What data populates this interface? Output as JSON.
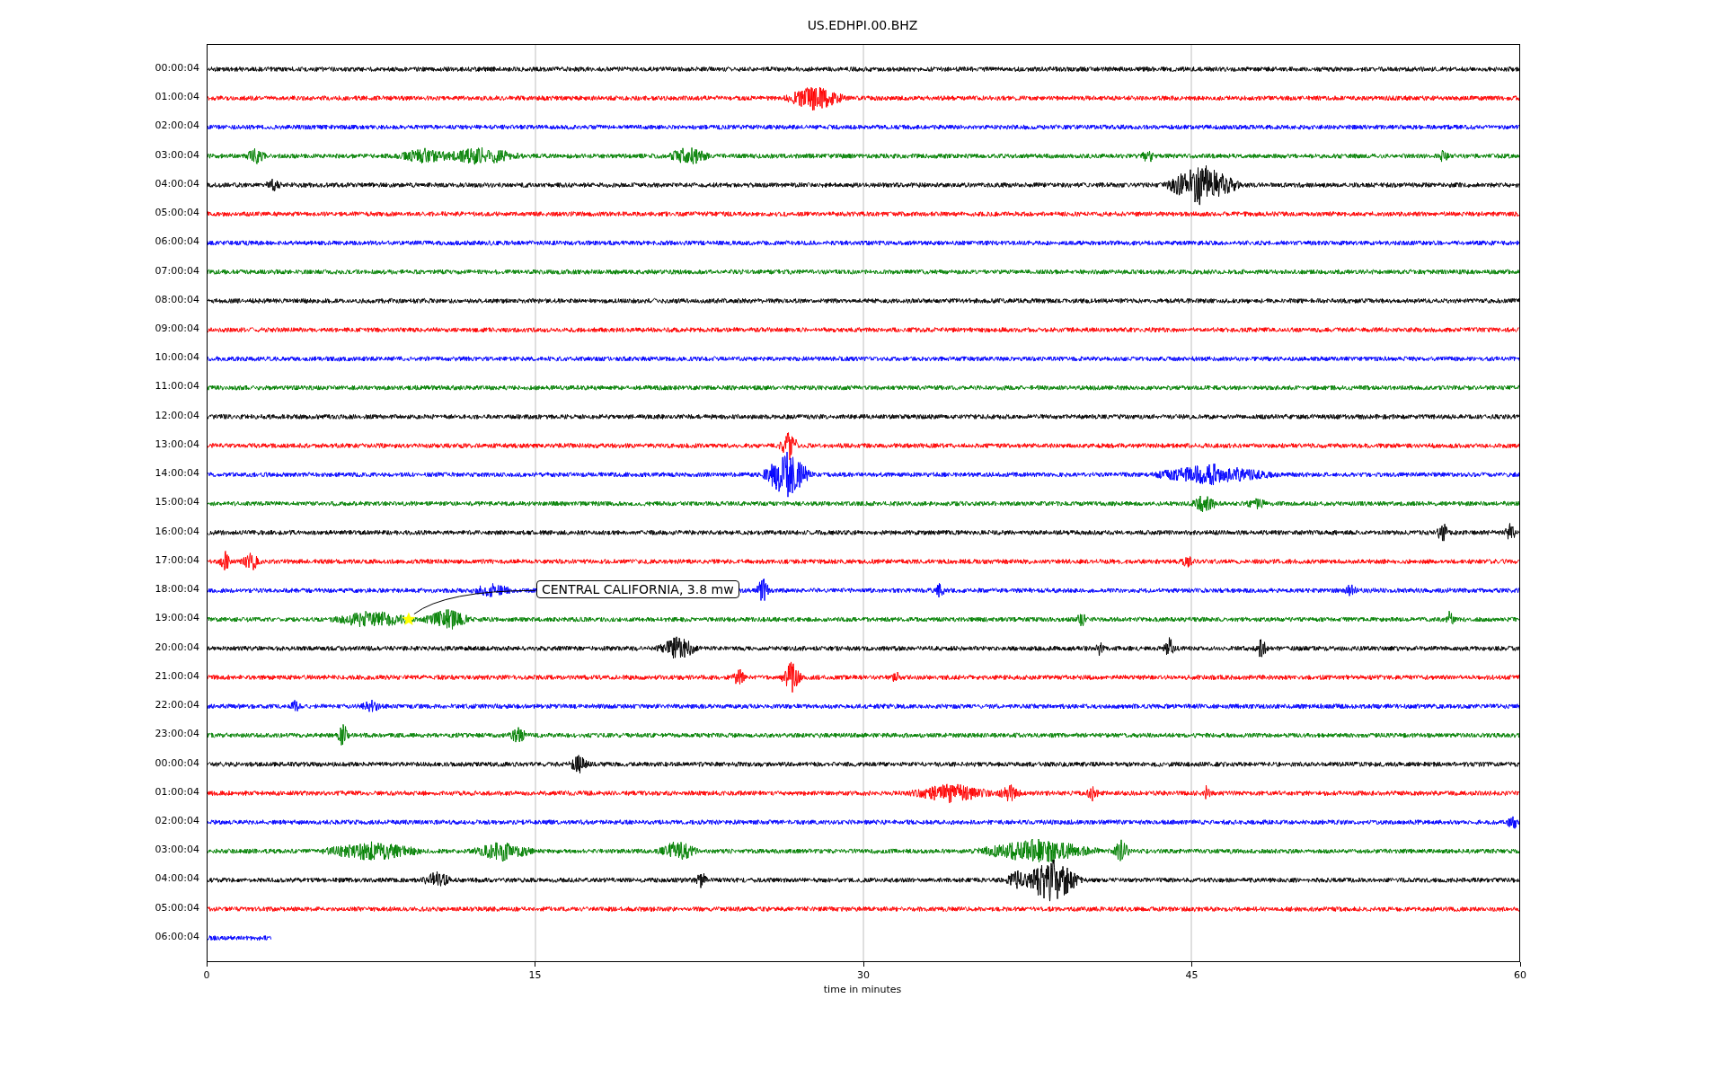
{
  "title": "US.EDHPI.00.BHZ",
  "traces": [
    {
      "label": "00:00:04",
      "color": "#000000"
    },
    {
      "label": "01:00:04",
      "color": "#ff0000"
    },
    {
      "label": "02:00:04",
      "color": "#0000ff"
    },
    {
      "label": "03:00:04",
      "color": "#008000"
    },
    {
      "label": "04:00:04",
      "color": "#000000"
    },
    {
      "label": "05:00:04",
      "color": "#ff0000"
    },
    {
      "label": "06:00:04",
      "color": "#0000ff"
    },
    {
      "label": "07:00:04",
      "color": "#008000"
    },
    {
      "label": "08:00:04",
      "color": "#000000"
    },
    {
      "label": "09:00:04",
      "color": "#ff0000"
    },
    {
      "label": "10:00:04",
      "color": "#0000ff"
    },
    {
      "label": "11:00:04",
      "color": "#008000"
    },
    {
      "label": "12:00:04",
      "color": "#000000"
    },
    {
      "label": "13:00:04",
      "color": "#ff0000"
    },
    {
      "label": "14:00:04",
      "color": "#0000ff"
    },
    {
      "label": "15:00:04",
      "color": "#008000"
    },
    {
      "label": "16:00:04",
      "color": "#000000"
    },
    {
      "label": "17:00:04",
      "color": "#ff0000"
    },
    {
      "label": "18:00:04",
      "color": "#0000ff"
    },
    {
      "label": "19:00:04",
      "color": "#008000"
    },
    {
      "label": "20:00:04",
      "color": "#000000"
    },
    {
      "label": "21:00:04",
      "color": "#ff0000"
    },
    {
      "label": "22:00:04",
      "color": "#0000ff"
    },
    {
      "label": "23:00:04",
      "color": "#008000"
    },
    {
      "label": "00:00:04",
      "color": "#000000"
    },
    {
      "label": "01:00:04",
      "color": "#ff0000"
    },
    {
      "label": "02:00:04",
      "color": "#0000ff"
    },
    {
      "label": "03:00:04",
      "color": "#008000"
    },
    {
      "label": "04:00:04",
      "color": "#000000"
    },
    {
      "label": "05:00:04",
      "color": "#ff0000"
    },
    {
      "label": "06:00:04",
      "color": "#0000ff"
    }
  ],
  "xaxis": {
    "label": "time in minutes",
    "ticks": [
      "0",
      "15",
      "30",
      "45",
      "60"
    ]
  },
  "annotation": {
    "text": "CENTRAL CALIFORNIA, 3.8 mw"
  }
}
